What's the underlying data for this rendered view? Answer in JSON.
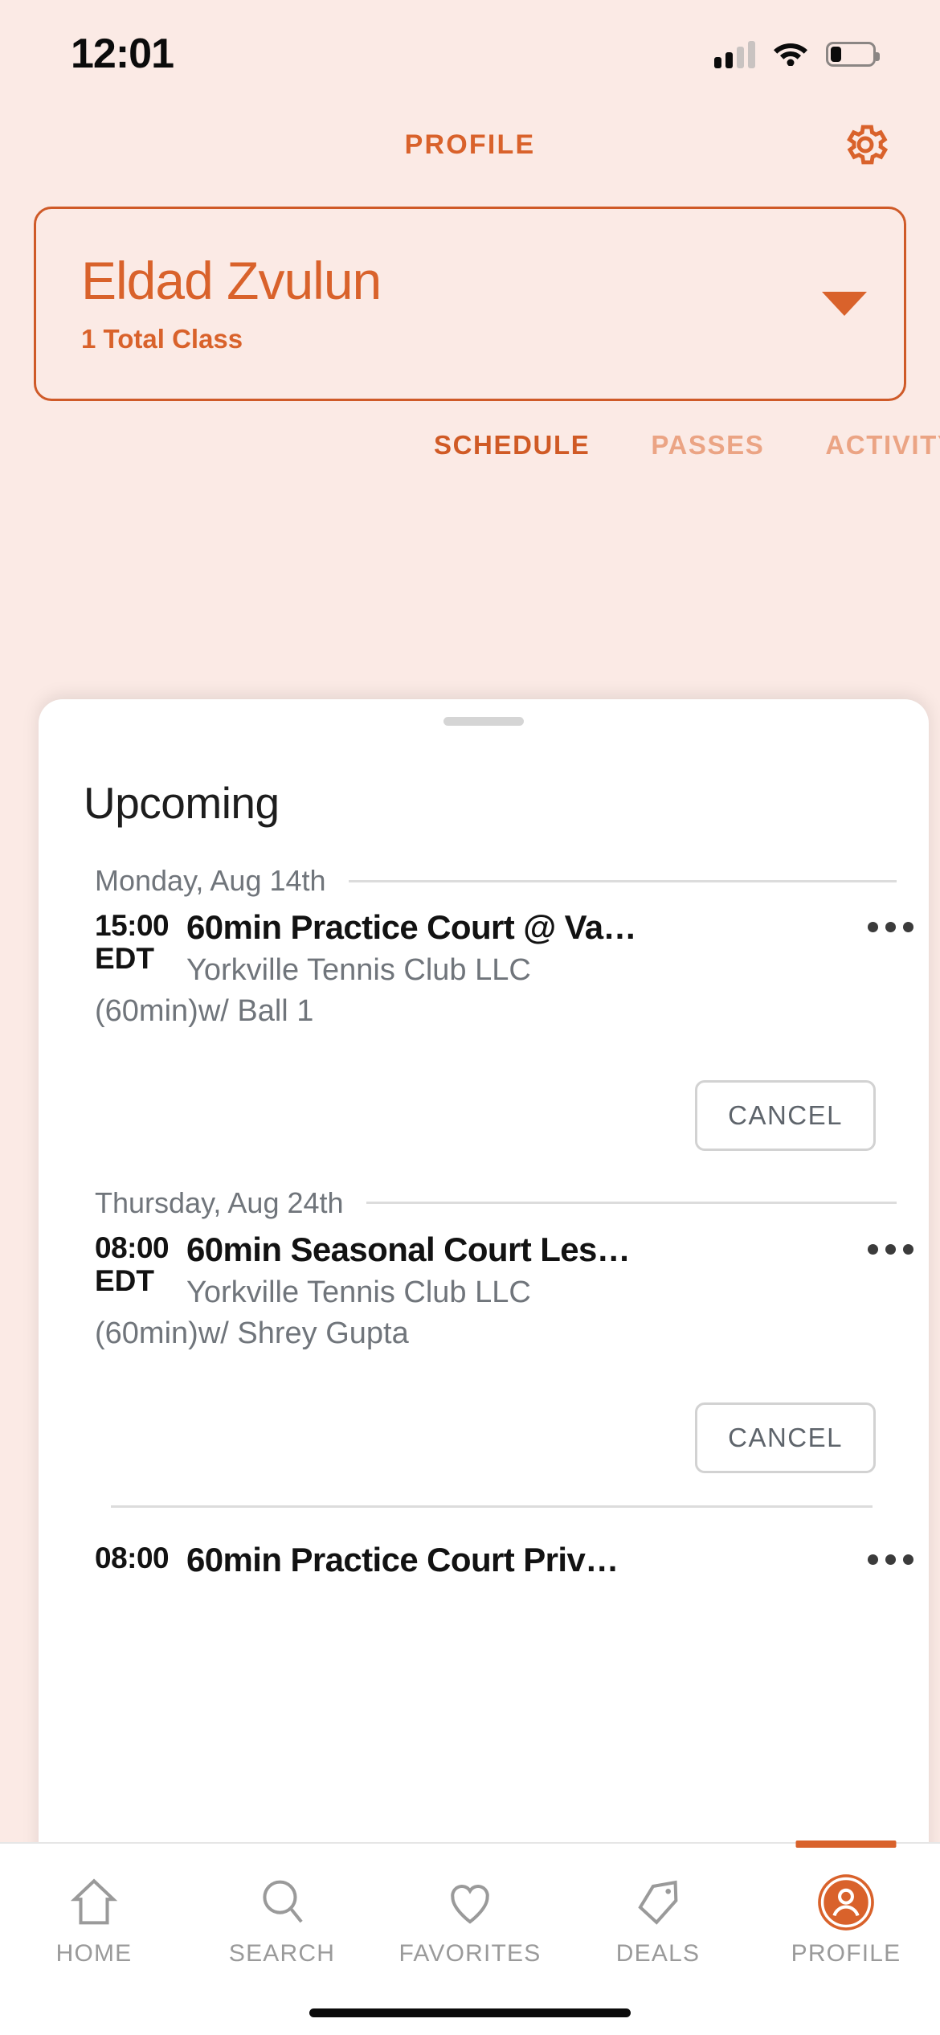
{
  "status_bar": {
    "time": "12:01",
    "signal_icon": "cellular-signal-icon",
    "wifi_icon": "wifi-icon",
    "battery_icon": "battery-low-icon",
    "signal_bars_filled": 2,
    "signal_bars_total": 4,
    "battery_level_percent": 25
  },
  "header": {
    "title": "PROFILE",
    "settings_icon": "gear-icon"
  },
  "profile_card": {
    "name": "Eldad Zvulun",
    "subtitle": "1 Total Class",
    "chevron_icon": "chevron-down-icon"
  },
  "tabs": [
    {
      "label": "SCHEDULE",
      "active": true
    },
    {
      "label": "PASSES",
      "active": false
    },
    {
      "label": "ACTIVITY",
      "active": false
    }
  ],
  "sheet": {
    "title": "Upcoming",
    "handle": "drag-handle"
  },
  "days": [
    {
      "date_label": "Monday, Aug 14th",
      "events": [
        {
          "time": "15:00",
          "timezone": "EDT",
          "duration": "(60min)",
          "title": "60min Practice Court @ Va…",
          "venue": "Yorkville Tennis Club LLC",
          "instructor": "w/ Ball 1",
          "menu_icon": "more-options-icon",
          "cancel_label": "CANCEL"
        }
      ]
    },
    {
      "date_label": "Thursday, Aug 24th",
      "events": [
        {
          "time": "08:00",
          "timezone": "EDT",
          "duration": "(60min)",
          "title": "60min Seasonal Court Les…",
          "venue": "Yorkville Tennis Club LLC",
          "instructor": "w/ Shrey Gupta",
          "menu_icon": "more-options-icon",
          "cancel_label": "CANCEL"
        },
        {
          "time": "08:00",
          "timezone": "",
          "duration": "",
          "title": "60min Practice Court Priv…",
          "venue": "",
          "instructor": "",
          "menu_icon": "more-options-icon",
          "cancel_label": ""
        }
      ]
    }
  ],
  "bottom_nav": [
    {
      "label": "HOME",
      "icon": "home-icon",
      "active": false
    },
    {
      "label": "SEARCH",
      "icon": "search-icon",
      "active": false
    },
    {
      "label": "FAVORITES",
      "icon": "heart-icon",
      "active": false
    },
    {
      "label": "DEALS",
      "icon": "tag-icon",
      "active": false
    },
    {
      "label": "PROFILE",
      "icon": "avatar-icon",
      "active": true
    }
  ],
  "colors": {
    "background": "#FBEAE5",
    "accent": "#D9622B",
    "accent_border": "#CF5A28",
    "tab_inactive": "#EBA484",
    "sheet_background": "#FFFFFF",
    "muted_text": "#70757b"
  }
}
